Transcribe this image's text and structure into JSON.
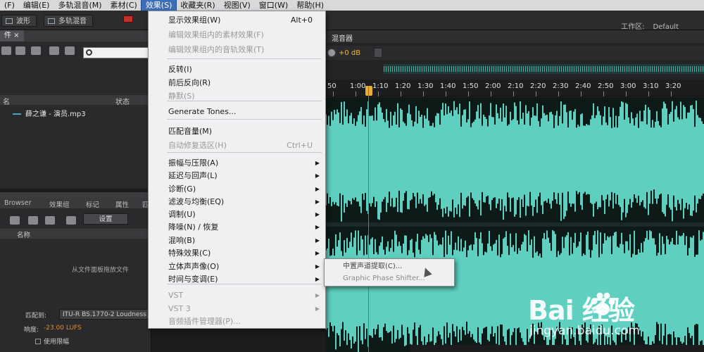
{
  "menubar": {
    "items": [
      {
        "label": "(F)",
        "active": false
      },
      {
        "label": "编辑(E)",
        "active": false
      },
      {
        "label": "多轨混音(M)",
        "active": false
      },
      {
        "label": "素材(C)",
        "active": false
      },
      {
        "label": "效果(S)",
        "active": true
      },
      {
        "label": "收藏夹(R)",
        "active": false
      },
      {
        "label": "视图(V)",
        "active": false
      },
      {
        "label": "窗口(W)",
        "active": false
      },
      {
        "label": "帮助(H)",
        "active": false
      }
    ]
  },
  "tabs": {
    "waveform": "波形",
    "multitrack": "多轨混音"
  },
  "workspace": {
    "label": "工作区:",
    "value": "Default"
  },
  "files_panel": {
    "tab": "件 ×",
    "col_name": "名",
    "col_status": "状态",
    "file_name": "薛之谦 - 演员.mp3"
  },
  "effects_panel": {
    "tabs": [
      "Browser",
      "效果组",
      "标记",
      "属性",
      "匹"
    ],
    "settings_label": "设置",
    "col_name": "名称",
    "hint": "从文件面板拖放文件",
    "loudness_label": "匹配到:",
    "loudness_value": "ITU-R BS.1770-2 Loudness",
    "target_label": "响度:",
    "target_value": "-23.00 LUFS",
    "use_limit_label": "使用限幅"
  },
  "effects_menu": {
    "items": [
      {
        "label": "显示效果组(W)",
        "shortcut": "Alt+0",
        "disabled": false,
        "submenu": false
      },
      {
        "label": "编辑效果组内的素材效果(F)",
        "shortcut": "",
        "disabled": true,
        "submenu": false
      },
      {
        "label": "编辑效果组内的音轨效果(T)",
        "shortcut": "",
        "disabled": true,
        "submenu": false
      },
      {
        "label": "反转(I)",
        "shortcut": "",
        "disabled": false,
        "submenu": false
      },
      {
        "label": "前后反向(R)",
        "shortcut": "",
        "disabled": false,
        "submenu": false
      },
      {
        "label": "静默(S)",
        "shortcut": "",
        "disabled": true,
        "submenu": false
      },
      {
        "label": "Generate Tones...",
        "shortcut": "",
        "disabled": false,
        "submenu": false
      },
      {
        "label": "匹配音量(M)",
        "shortcut": "",
        "disabled": false,
        "submenu": false
      },
      {
        "label": "自动修复选区(H)",
        "shortcut": "Ctrl+U",
        "disabled": true,
        "submenu": false
      },
      {
        "label": "振幅与压限(A)",
        "shortcut": "",
        "disabled": false,
        "submenu": true
      },
      {
        "label": "延迟与回声(L)",
        "shortcut": "",
        "disabled": false,
        "submenu": true
      },
      {
        "label": "诊断(G)",
        "shortcut": "",
        "disabled": false,
        "submenu": true
      },
      {
        "label": "滤波与均衡(EQ)",
        "shortcut": "",
        "disabled": false,
        "submenu": true
      },
      {
        "label": "调制(U)",
        "shortcut": "",
        "disabled": false,
        "submenu": true
      },
      {
        "label": "降噪(N) / 恢复",
        "shortcut": "",
        "disabled": false,
        "submenu": true
      },
      {
        "label": "混响(B)",
        "shortcut": "",
        "disabled": false,
        "submenu": true
      },
      {
        "label": "特殊效果(C)",
        "shortcut": "",
        "disabled": false,
        "submenu": true
      },
      {
        "label": "立体声声像(O)",
        "shortcut": "",
        "disabled": false,
        "submenu": true
      },
      {
        "label": "时间与变调(E)",
        "shortcut": "",
        "disabled": false,
        "submenu": true
      },
      {
        "label": "VST",
        "shortcut": "",
        "disabled": true,
        "submenu": true
      },
      {
        "label": "VST 3",
        "shortcut": "",
        "disabled": true,
        "submenu": true
      },
      {
        "label": "音频插件管理器(P)...",
        "shortcut": "",
        "disabled": true,
        "submenu": false
      }
    ]
  },
  "stereo_submenu": {
    "items": [
      "中置声道提取(C)...",
      "Graphic Phase Shifter..."
    ]
  },
  "editor": {
    "tab": "混音器",
    "volume": "+0 dB",
    "ruler": [
      "50",
      "1:00",
      "1:10",
      "1:20",
      "1:30",
      "1:40",
      "1:50",
      "2:00",
      "2:10",
      "2:20",
      "2:30",
      "2:40",
      "2:50",
      "3:00",
      "3:10",
      "3:20"
    ],
    "wave_color": "#5fd0c0"
  },
  "watermark": {
    "logo": "Bai 经验",
    "url": "jingyan.baidu.com"
  }
}
